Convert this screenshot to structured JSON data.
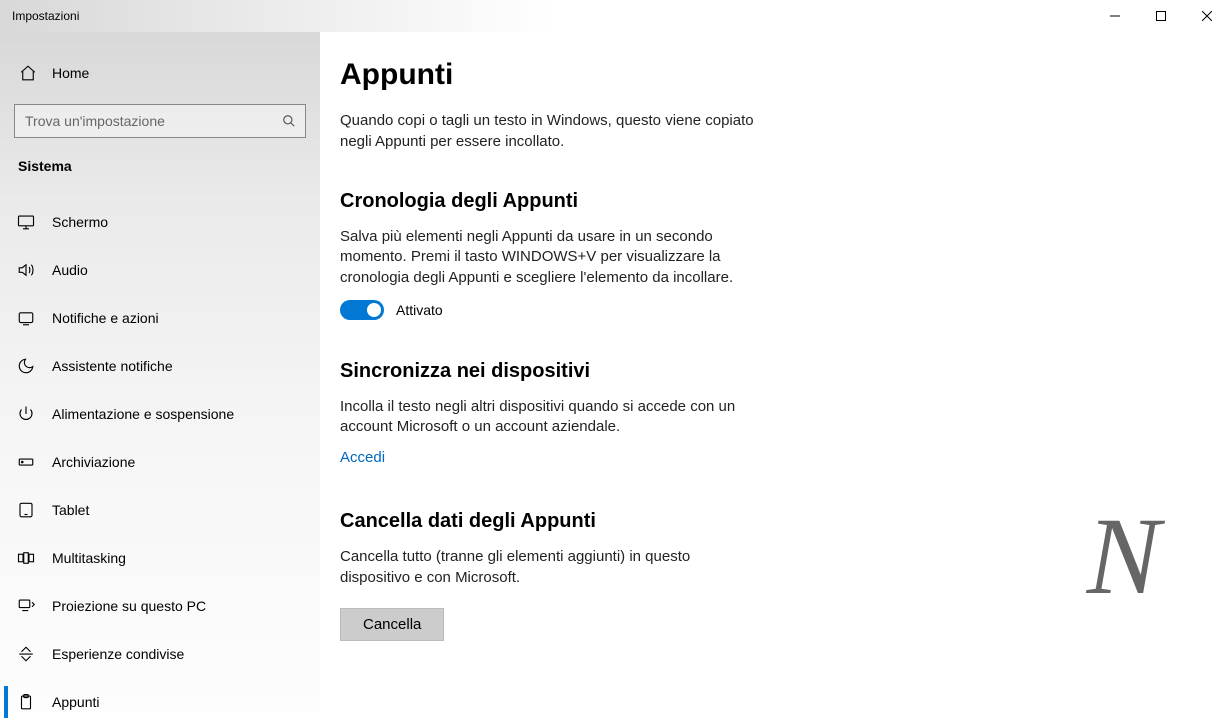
{
  "window": {
    "title": "Impostazioni"
  },
  "sidebar": {
    "home": "Home",
    "search_placeholder": "Trova un'impostazione",
    "section": "Sistema",
    "items": [
      {
        "label": "Schermo",
        "icon": "monitor-icon"
      },
      {
        "label": "Audio",
        "icon": "sound-icon"
      },
      {
        "label": "Notifiche e azioni",
        "icon": "notifications-icon"
      },
      {
        "label": "Assistente notifiche",
        "icon": "moon-icon"
      },
      {
        "label": "Alimentazione e sospensione",
        "icon": "power-icon"
      },
      {
        "label": "Archiviazione",
        "icon": "storage-icon"
      },
      {
        "label": "Tablet",
        "icon": "tablet-icon"
      },
      {
        "label": "Multitasking",
        "icon": "multitasking-icon"
      },
      {
        "label": "Proiezione su questo PC",
        "icon": "projection-icon"
      },
      {
        "label": "Esperienze condivise",
        "icon": "shared-icon"
      },
      {
        "label": "Appunti",
        "icon": "clipboard-icon",
        "active": true
      }
    ]
  },
  "main": {
    "title": "Appunti",
    "description": "Quando copi o tagli un testo in Windows, questo viene copiato negli Appunti per essere incollato.",
    "history": {
      "title": "Cronologia degli Appunti",
      "description": "Salva più elementi negli Appunti da usare in un secondo momento. Premi il tasto WINDOWS+V per visualizzare la cronologia degli Appunti e scegliere l'elemento da incollare.",
      "toggle_label": "Attivato",
      "toggle_on": true
    },
    "sync": {
      "title": "Sincronizza nei dispositivi",
      "description": "Incolla il testo negli altri dispositivi quando si accede con un account Microsoft o un account aziendale.",
      "link": "Accedi"
    },
    "clear": {
      "title": "Cancella dati degli Appunti",
      "description": "Cancella tutto (tranne gli elementi aggiunti) in questo dispositivo e con Microsoft.",
      "button": "Cancella"
    }
  },
  "watermark": "N"
}
